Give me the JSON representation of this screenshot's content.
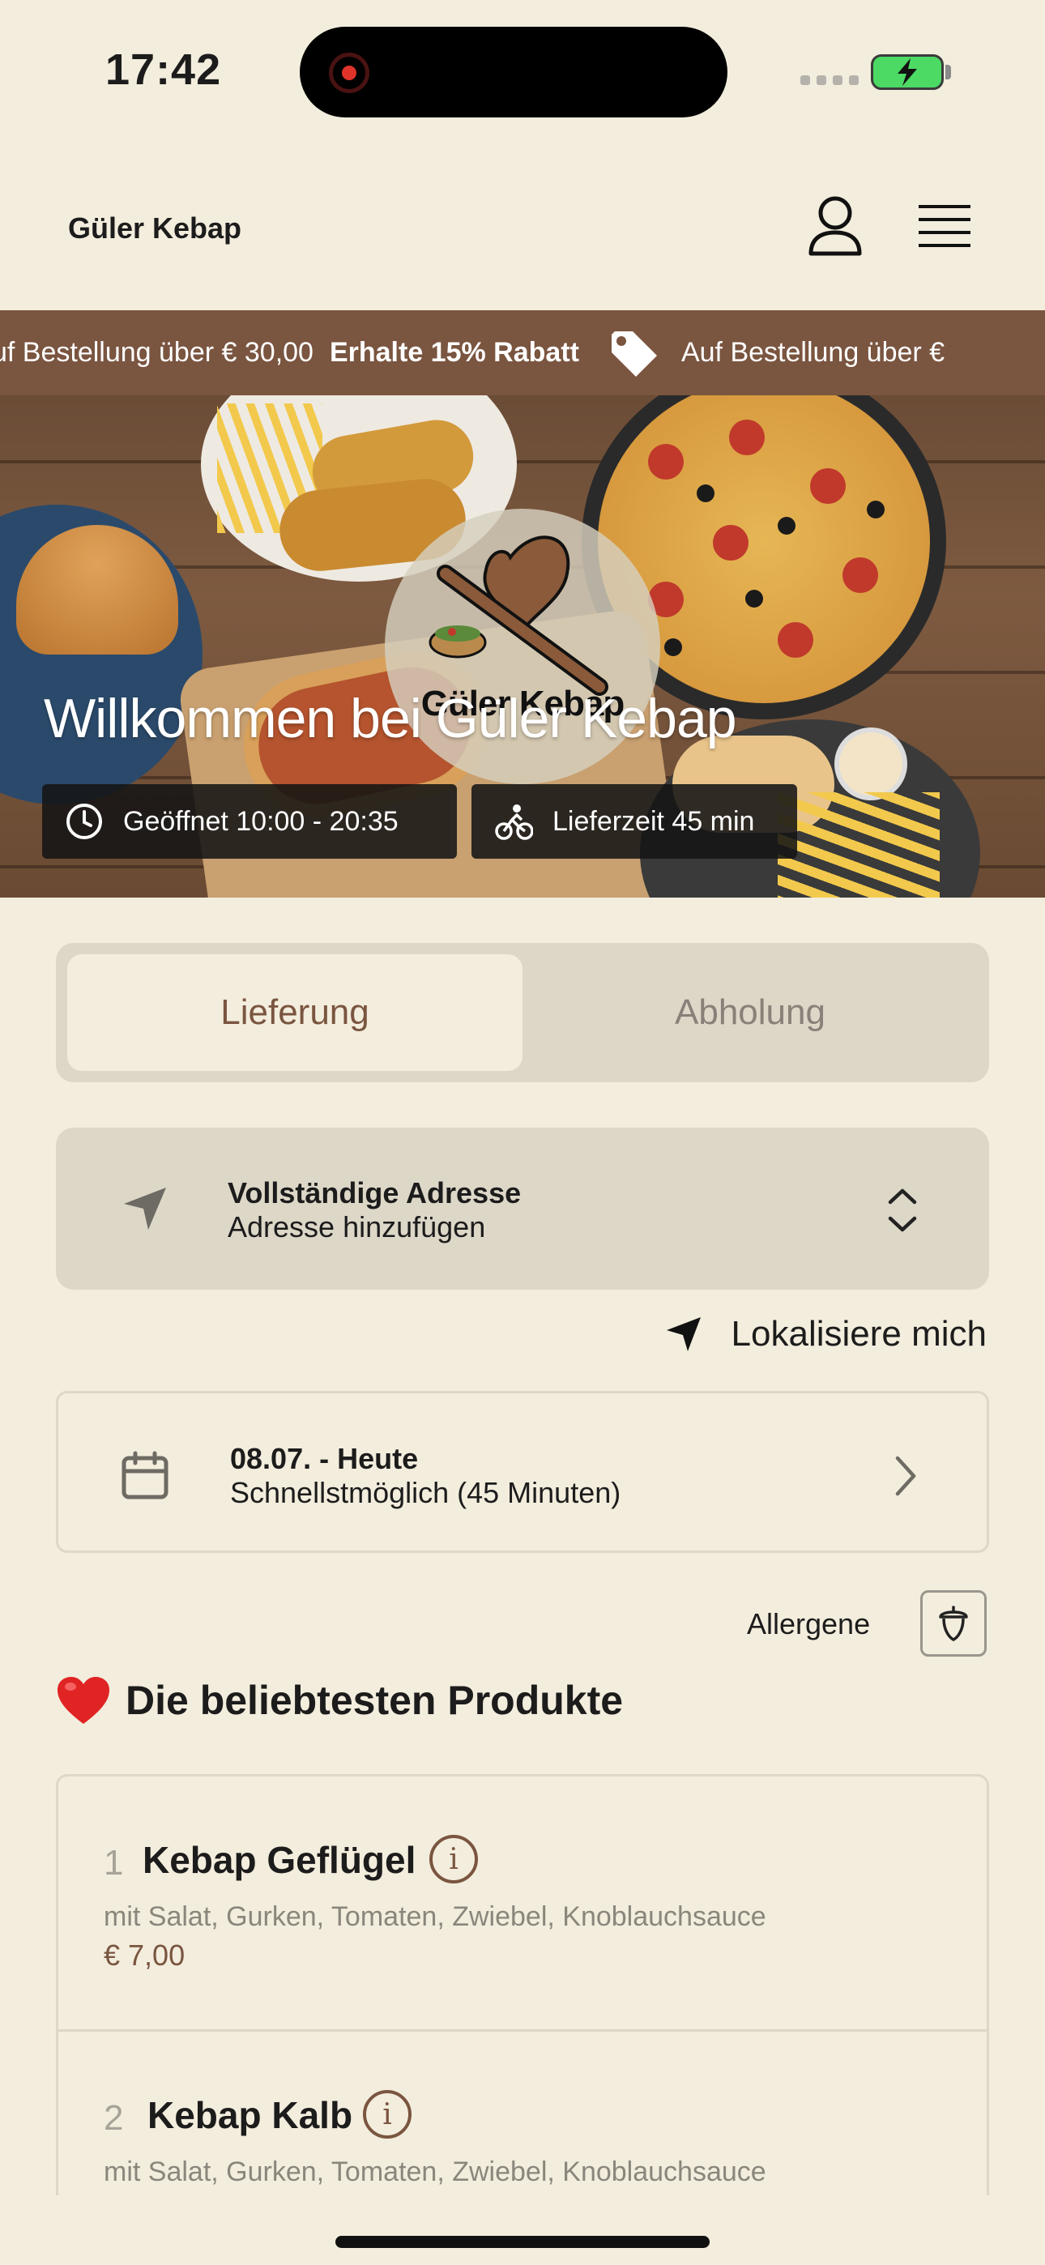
{
  "status_bar": {
    "time": "17:42"
  },
  "header": {
    "title": "Güler Kebap"
  },
  "promo": {
    "text": "Auf Bestellung über € 30,00",
    "highlight": "Erhalte 15% Rabatt",
    "text_leading": "uf Bestellung über € 30,00",
    "text_trailing": "Auf Bestellung über €"
  },
  "hero": {
    "logo_text": "Güler Kebap",
    "welcome": "Willkommen bei Güler Kebap",
    "opening_hours": "Geöffnet 10:00 - 20:35",
    "delivery_time": "Lieferzeit 45 min"
  },
  "order_mode": {
    "delivery": "Lieferung",
    "pickup": "Abholung",
    "selected": "Lieferung"
  },
  "address": {
    "title": "Vollständige Adresse",
    "subtitle": "Adresse hinzufügen"
  },
  "locate_me": "Lokalisiere mich",
  "schedule": {
    "date": "08.07. - Heute",
    "time": "Schnellstmöglich (45 Minuten)"
  },
  "allergens_label": "Allergene",
  "popular": {
    "title": "Die beliebtesten Produkte",
    "items": [
      {
        "number": "1",
        "name": "Kebap Geflügel",
        "description": "mit Salat, Gurken, Tomaten, Zwiebel, Knoblauchsauce",
        "price": "€ 7,00"
      },
      {
        "number": "2",
        "name": "Kebap Kalb",
        "description": "mit Salat, Gurken, Tomaten, Zwiebel, Knoblauchsauce"
      }
    ]
  },
  "colors": {
    "background": "#f3eddd",
    "accent_brown": "#7a5540",
    "card_grey": "#ddd7c8",
    "heart_red": "#e02424"
  }
}
